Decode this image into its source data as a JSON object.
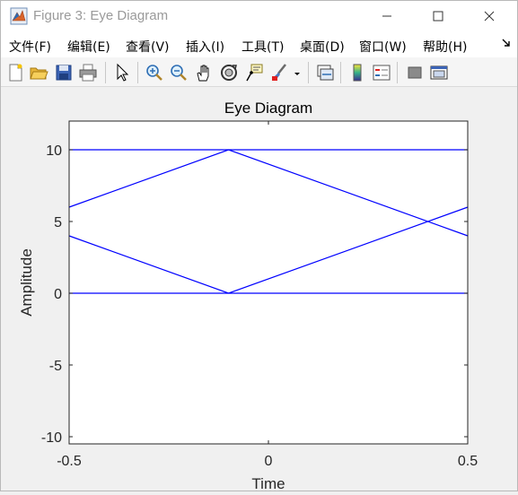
{
  "window": {
    "title": "Figure 3: Eye Diagram"
  },
  "menu": [
    {
      "label": "文件(F)"
    },
    {
      "label": "编辑(E)"
    },
    {
      "label": "查看(V)"
    },
    {
      "label": "插入(I)"
    },
    {
      "label": "工具(T)"
    },
    {
      "label": "桌面(D)"
    },
    {
      "label": "窗口(W)"
    },
    {
      "label": "帮助(H)"
    }
  ],
  "toolbar": [
    {
      "icon": "new-figure-icon"
    },
    {
      "icon": "open-file-icon"
    },
    {
      "icon": "save-icon"
    },
    {
      "icon": "print-icon"
    },
    {
      "icon": "select-arrow-icon"
    },
    {
      "icon": "zoom-in-icon"
    },
    {
      "icon": "zoom-out-icon"
    },
    {
      "icon": "pan-hand-icon"
    },
    {
      "icon": "rotate-3d-icon"
    },
    {
      "icon": "data-cursor-icon"
    },
    {
      "icon": "brush-icon"
    },
    {
      "icon": "brush-dropdown-icon"
    },
    {
      "icon": "link-plot-icon"
    },
    {
      "icon": "colorbar-icon"
    },
    {
      "icon": "legend-icon"
    },
    {
      "icon": "hide-plot-tools-icon"
    },
    {
      "icon": "show-plot-tools-icon"
    }
  ],
  "chart_data": {
    "type": "line",
    "title": "Eye Diagram",
    "xlabel": "Time",
    "ylabel": "Amplitude",
    "xlim": [
      -0.5,
      0.5
    ],
    "ylim": [
      -10.5,
      12
    ],
    "xticks": [
      -0.5,
      0,
      0.5
    ],
    "xtick_labels": [
      "-0.5",
      "0",
      "0.5"
    ],
    "yticks": [
      -10,
      -5,
      0,
      5,
      10
    ],
    "ytick_labels": [
      "-10",
      "-5",
      "0",
      "5",
      "10"
    ],
    "grid": false,
    "legend": "none",
    "line_color": "#0000ff",
    "series": [
      {
        "x": [
          -0.5,
          0.5
        ],
        "y": [
          10,
          10
        ]
      },
      {
        "x": [
          -0.5,
          -0.1,
          0.5
        ],
        "y": [
          6,
          10,
          4
        ]
      },
      {
        "x": [
          -0.5,
          -0.1,
          0.5
        ],
        "y": [
          4,
          0,
          6
        ]
      },
      {
        "x": [
          -0.5,
          0.5
        ],
        "y": [
          0,
          0
        ]
      }
    ]
  },
  "colors": {
    "axes_background": "#ffffff",
    "figure_background": "#f0f0f0",
    "line": "#0000ff"
  }
}
